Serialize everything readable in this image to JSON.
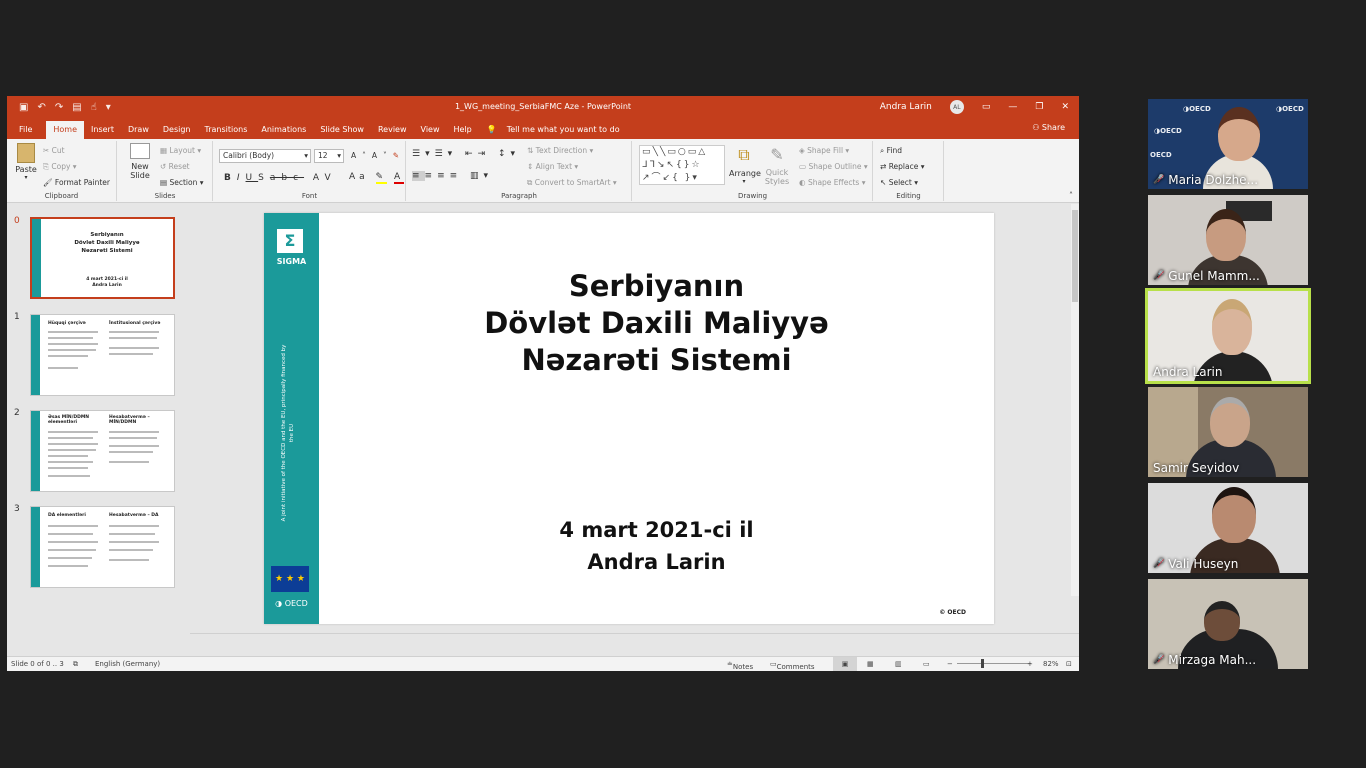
{
  "window": {
    "title": "1_WG_meeting_SerbiaFMC Aze  -  PowerPoint",
    "user": "Andra Larin",
    "user_initials": "AL"
  },
  "menu": {
    "tabs": [
      "File",
      "Home",
      "Insert",
      "Draw",
      "Design",
      "Transitions",
      "Animations",
      "Slide Show",
      "Review",
      "View",
      "Help"
    ],
    "active": "Home",
    "tell_me": "Tell me what you want to do",
    "share": "Share"
  },
  "ribbon": {
    "clipboard": {
      "paste": "Paste",
      "cut": "Cut",
      "copy": "Copy",
      "format_painter": "Format Painter",
      "label": "Clipboard"
    },
    "slides": {
      "new_slide": "New",
      "new_slide2": "Slide",
      "layout": "Layout",
      "reset": "Reset",
      "section": "Section",
      "label": "Slides"
    },
    "font": {
      "name": "Calibri (Body)",
      "size": "12",
      "label": "Font"
    },
    "paragraph": {
      "text_direction": "Text Direction",
      "align_text": "Align Text",
      "convert": "Convert to SmartArt",
      "label": "Paragraph"
    },
    "drawing": {
      "arrange": "Arrange",
      "quick_styles": "Quick",
      "quick_styles2": "Styles",
      "shape_fill": "Shape Fill",
      "shape_outline": "Shape Outline",
      "shape_effects": "Shape Effects",
      "label": "Drawing"
    },
    "editing": {
      "find": "Find",
      "replace": "Replace",
      "select": "Select",
      "label": "Editing"
    }
  },
  "thumbnails": [
    {
      "num": "0",
      "title1": "Serbiyanın",
      "title2": "Dövlət Daxili Maliyyə",
      "title3": "Nəzarəti Sistemi",
      "sub1": "4 mart 2021-ci il",
      "sub2": "Andra Larin"
    },
    {
      "num": "1",
      "left_title": "Hüquqi çərçivə",
      "right_title": "İnstitusional çərçivə"
    },
    {
      "num": "2",
      "left_title": "Əsas MİN/DDMN elementləri",
      "right_title": "Hesabatvermə – MİN/DDMN"
    },
    {
      "num": "3",
      "left_title": "DA elementləri",
      "right_title": "Hesabatvermə – DA"
    }
  ],
  "slide": {
    "brand": "SIGMA",
    "sigma_symbol": "Σ",
    "vertical_text": "A joint initiative of the OECD and the EU, principally financed by the EU",
    "eu_stars": "★ ★ ★",
    "oecd": "OECD",
    "title_line1": "Serbiyanın",
    "title_line2": "Dövlət Daxili Maliyyə",
    "title_line3": "Nəzarəti Sistemi",
    "date": "4 mart 2021-ci il",
    "presenter": "Andra Larin",
    "copyright": "© OECD"
  },
  "status": {
    "slide_info": "Slide 0 of 0 .. 3",
    "language": "English (Germany)",
    "notes": "Notes",
    "comments": "Comments",
    "zoom": "82%"
  },
  "participants": [
    {
      "name": "Maria Dolzhe...",
      "muted": true
    },
    {
      "name": "Gunel Mamm...",
      "muted": true
    },
    {
      "name": "Andra Larin",
      "muted": false,
      "speaking": true
    },
    {
      "name": "Samir Seyidov",
      "muted": false
    },
    {
      "name": "Vali Huseyn",
      "muted": true
    },
    {
      "name": "Mirzaga Mah...",
      "muted": true
    }
  ],
  "colors": {
    "accent": "#c43e1c",
    "sigma_teal": "#1b9a9a",
    "speaker_border": "#b8e04a"
  }
}
